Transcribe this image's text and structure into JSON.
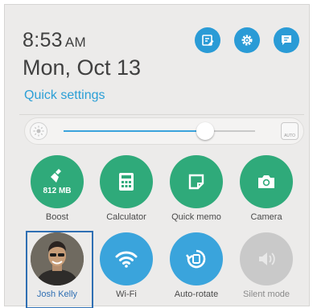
{
  "status": {
    "time": "8:53",
    "ampm": "AM",
    "date": "Mon, Oct 13"
  },
  "header": {
    "quick_settings_label": "Quick settings",
    "buttons": [
      {
        "name": "edit-notes-icon"
      },
      {
        "name": "settings-gear-icon"
      },
      {
        "name": "notification-list-icon"
      }
    ]
  },
  "brightness": {
    "level": 0.74,
    "auto_label": "AUTO"
  },
  "tiles": [
    {
      "label": "Boost",
      "sublabel": "812 MB",
      "icon": "broom-icon",
      "color": "#2faa7a",
      "active": true
    },
    {
      "label": "Calculator",
      "icon": "calculator-icon",
      "color": "#2faa7a",
      "active": true
    },
    {
      "label": "Quick memo",
      "icon": "memo-icon",
      "color": "#2faa7a",
      "active": true
    },
    {
      "label": "Camera",
      "icon": "camera-icon",
      "color": "#2faa7a",
      "active": true
    },
    {
      "label": "Josh Kelly",
      "icon": "avatar",
      "active": true
    },
    {
      "label": "Wi-Fi",
      "icon": "wifi-icon",
      "color": "#3aa4dc",
      "active": true
    },
    {
      "label": "Auto-rotate",
      "icon": "rotate-icon",
      "color": "#3aa4dc",
      "active": true
    },
    {
      "label": "Silent mode",
      "icon": "speaker-icon",
      "color": "#c9c9c9",
      "active": false
    }
  ],
  "colors": {
    "accent": "#2b9fd6",
    "green": "#2faa7a",
    "blue": "#3aa4dc",
    "panel": "#ecebea"
  }
}
